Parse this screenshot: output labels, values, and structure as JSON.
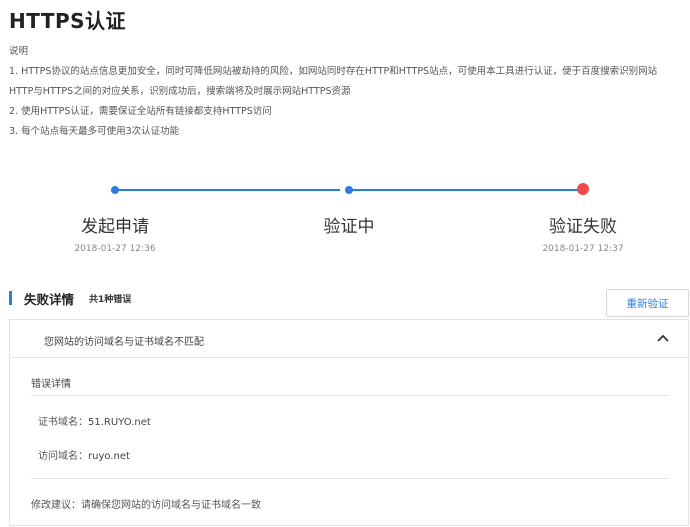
{
  "page": {
    "title": "HTTPS认证"
  },
  "description": {
    "heading": "说明",
    "lines": [
      "1. HTTPS协议的站点信息更加安全，同时可降低网站被劫持的风险，如网站同时存在HTTP和HTTPS站点，可使用本工具进行认证，便于百度搜索识别网站",
      "HTTP与HTTPS之间的对应关系，识别成功后，搜索端将及时展示网站HTTPS资源",
      "2. 使用HTTPS认证，需要保证全站所有链接都支持HTTPS访问",
      "3. 每个站点每天最多可使用3次认证功能"
    ]
  },
  "steps": [
    {
      "label": "发起申请",
      "time": "2018-01-27 12:36"
    },
    {
      "label": "验证中",
      "time": ""
    },
    {
      "label": "验证失败",
      "time": "2018-01-27 12:37"
    }
  ],
  "colors": {
    "accent": "#2b7de1",
    "fail": "#ef4b4b"
  },
  "fail_section": {
    "title": "失败详情",
    "count": "共1种错误",
    "reverify_label": "重新验证"
  },
  "error": {
    "summary": "您网站的访问域名与证书域名不匹配",
    "detail_title": "错误详情",
    "cert_domain_label": "证书域名：",
    "cert_domain": "51.RUYO.net",
    "visit_domain_label": "访问域名：",
    "visit_domain": "ruyo.net",
    "advice_label": "修改建议：",
    "advice": "请确保您网站的访问域名与证书域名一致"
  }
}
